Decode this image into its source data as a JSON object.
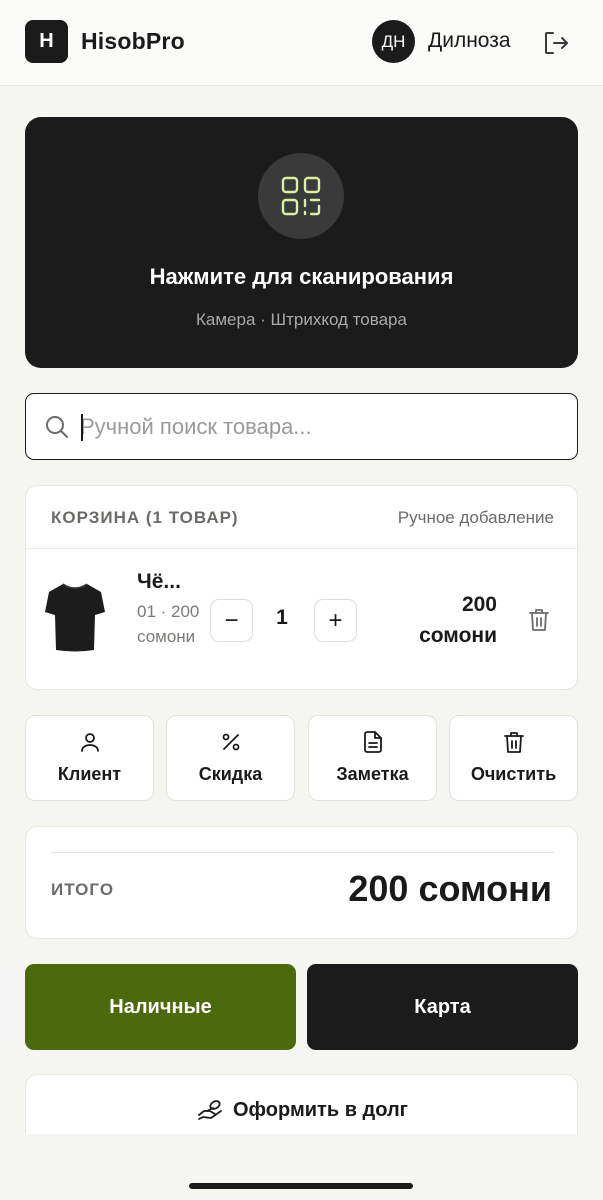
{
  "header": {
    "logo_letter": "H",
    "app_title": "HisobPro",
    "avatar_initials": "ДН",
    "user_name": "Дилноза",
    "logout_icon": "logout-icon"
  },
  "scan": {
    "icon": "qr-scan-icon",
    "title": "Нажмите для сканирования",
    "subtitle": "Камера · Штрихкод товара",
    "accent_color": "#d9f0a3"
  },
  "search": {
    "placeholder": "Ручной поиск товара...",
    "value": "",
    "icon": "search-icon"
  },
  "cart": {
    "title": "КОРЗИНА (1 ТОВАР)",
    "manual_add_label": "Ручное добавление",
    "items": [
      {
        "name": "Чё...",
        "meta": "01 · 200 сомони",
        "quantity": "1",
        "minus_label": "−",
        "plus_label": "+",
        "price": "200 сомони",
        "image_icon": "tshirt-icon",
        "delete_icon": "trash-icon"
      }
    ]
  },
  "actions": [
    {
      "label": "Клиент",
      "icon": "user-icon"
    },
    {
      "label": "Скидка",
      "icon": "percent-icon"
    },
    {
      "label": "Заметка",
      "icon": "note-icon"
    },
    {
      "label": "Очистить",
      "icon": "trash-icon"
    }
  ],
  "total": {
    "label": "ИТОГО",
    "value": "200 сомони"
  },
  "payment": {
    "cash_label": "Наличные",
    "card_label": "Карта",
    "cash_color": "#4b6a0c",
    "card_color": "#1b1b1b"
  },
  "debt": {
    "label": "Оформить в долг",
    "icon": "hand-money-icon"
  }
}
